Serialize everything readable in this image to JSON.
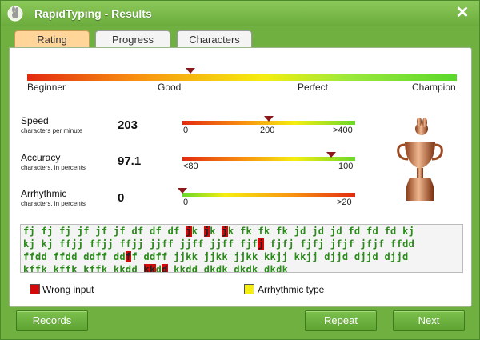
{
  "window": {
    "title": "RapidTyping - Results",
    "close_glyph": "✕"
  },
  "tabs": [
    {
      "label": "Rating",
      "active": true
    },
    {
      "label": "Progress",
      "active": false
    },
    {
      "label": "Characters",
      "active": false
    }
  ],
  "rating_scale": {
    "labels": [
      "Beginner",
      "Good",
      "Perfect",
      "Champion"
    ],
    "level": 0.38
  },
  "stats": {
    "speed": {
      "name": "Speed",
      "sub": "characters per minute",
      "value": "203",
      "ticks": [
        "0",
        "200",
        ">400"
      ],
      "level": 0.5
    },
    "accuracy": {
      "name": "Accuracy",
      "sub": "characters, in percents",
      "value": "97.1",
      "ticks": [
        "<80",
        "100"
      ],
      "level": 0.86
    },
    "arrhythmic": {
      "name": "Arrhythmic",
      "sub": "characters, in percents",
      "value": "0",
      "ticks": [
        "0",
        ">20"
      ],
      "level": 0.0
    }
  },
  "typed_text": {
    "lines": [
      [
        {
          "t": "fj fj fj jf jf jf df df df "
        },
        {
          "t": "j",
          "err": true
        },
        {
          "t": "k "
        },
        {
          "t": "j",
          "err": true
        },
        {
          "t": "k "
        },
        {
          "t": "j",
          "err": true
        },
        {
          "t": "k fk fk fk jd jd jd fd fd fd kj"
        }
      ],
      [
        {
          "t": "kj kj ffjj ffjj ffjj jjff jjff jjff fjf"
        },
        {
          "t": "j",
          "err": true
        },
        {
          "t": " fjfj fjfj jfjf jfjf ffdd"
        }
      ],
      [
        {
          "t": "ffdd ffdd ddff dd"
        },
        {
          "t": "f",
          "err": true
        },
        {
          "t": "f ddff jjkk jjkk jjkk kkjj kkjj djjd djjd djjd"
        }
      ],
      [
        {
          "t": "kffk kffk kffk kkdd "
        },
        {
          "t": "kk",
          "err": true
        },
        {
          "t": "d"
        },
        {
          "t": "d",
          "err": true
        },
        {
          "t": " kkdd dkdk dkdk dkdk"
        }
      ]
    ]
  },
  "legend": {
    "wrong": "Wrong input",
    "arrhythmic": "Arrhythmic type"
  },
  "colors": {
    "wrong": "#d40a0a",
    "arrhythmic": "#f5ee10",
    "accent": "#6fb040"
  },
  "buttons": {
    "records": "Records",
    "repeat": "Repeat",
    "next": "Next"
  }
}
